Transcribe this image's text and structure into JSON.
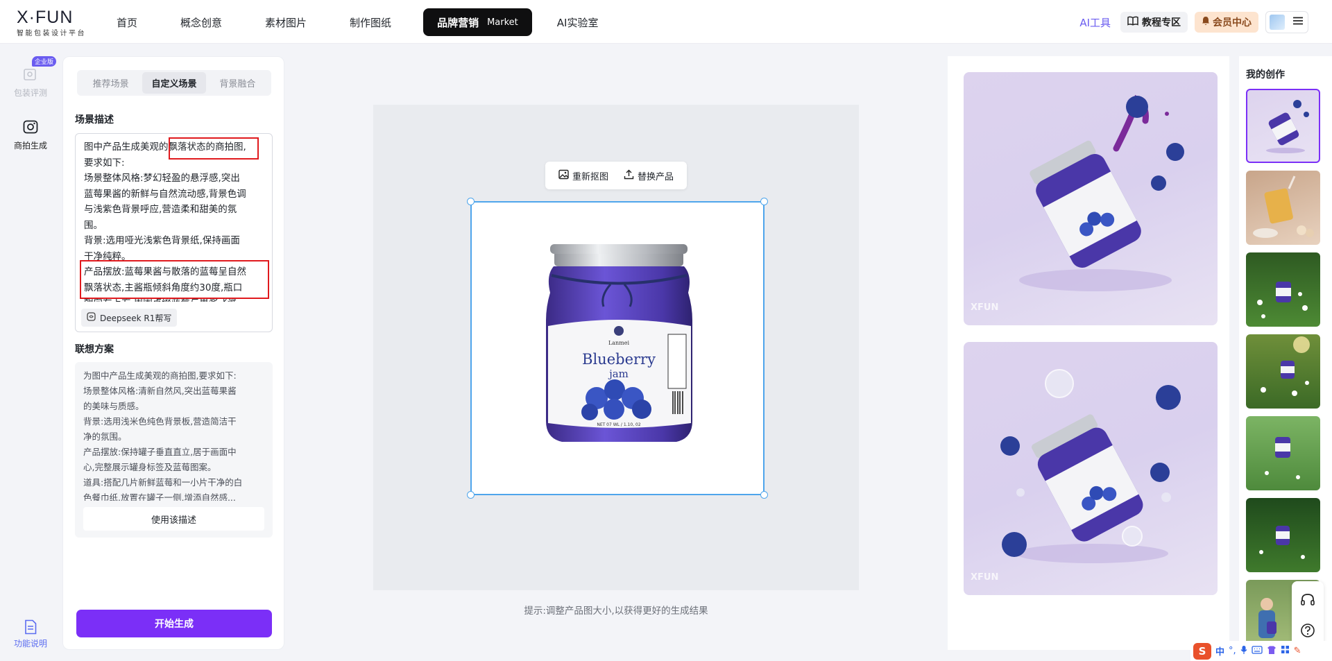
{
  "header": {
    "logo_main": "X·FUN",
    "logo_sub": "智能包装设计平台",
    "nav": [
      {
        "label": "首页"
      },
      {
        "label": "概念创意"
      },
      {
        "label": "素材图片"
      },
      {
        "label": "制作图纸"
      },
      {
        "label": "品牌营销",
        "sub": "Market",
        "active": true
      },
      {
        "label": "AI实验室"
      }
    ],
    "ai_tools": "AI工具",
    "tutorial": "教程专区",
    "member": "会员中心"
  },
  "rail": {
    "items": [
      {
        "label": "包装评测",
        "badge": "企业版",
        "icon": "package-review-icon"
      },
      {
        "label": "商拍生成",
        "icon": "camera-icon"
      }
    ],
    "bottom": {
      "label": "功能说明",
      "icon": "document-icon"
    }
  },
  "panel": {
    "tabs": [
      "推荐场景",
      "自定义场景",
      "背景融合"
    ],
    "active_tab": 1,
    "scene_title": "场景描述",
    "scene_lines": [
      "图中产品生成美观的飘落状态的商拍图,",
      "要求如下:",
      "场景整体风格:梦幻轻盈的悬浮感,突出",
      "蓝莓果酱的新鲜与自然流动感,背景色调",
      "与浅紫色背景呼应,营造柔和甜美的氛",
      "围。",
      "背景:选用哑光浅紫色背景纸,保持画面",
      "干净纯粹。",
      "产品摆放:蓝莓果酱与散落的蓝莓呈自然",
      "飘落状态,主酱瓶倾斜角度约30度,瓶口",
      "朝向右上方,周围点缀蓝莓与果酱飞溅。"
    ],
    "deepseek_btn": "Deepseek R1帮写",
    "plan_title": "联想方案",
    "plan_lines": [
      "为图中产品生成美观的商拍图,要求如下:",
      "场景整体风格:清新自然风,突出蓝莓果酱",
      "的美味与质感。",
      "背景:选用浅米色纯色背景板,营造简洁干",
      "净的氛围。",
      "产品摆放:保持罐子垂直直立,居于画面中",
      "心,完整展示罐身标签及蓝莓图案。",
      "道具:搭配几片新鲜蓝莓和一小片干净的白",
      "色餐巾纸,放置在罐子一侧,增添自然感..."
    ],
    "use_btn": "使用该描述",
    "generate_btn": "开始生成"
  },
  "canvas": {
    "rematting": "重新抠图",
    "replace": "替换产品",
    "hint": "提示:调整产品图大小,以获得更好的生成结果",
    "jar": {
      "brand": "Lanmei",
      "title": "Blueberry",
      "subtitle": "jam",
      "net": "NET 07 WL / 1.10, 02"
    }
  },
  "results": {
    "watermark": "XFUN"
  },
  "history": {
    "title": "我的创作"
  },
  "ime": {
    "lang": "中"
  },
  "colors": {
    "accent": "#7b2ff7",
    "brand": "#6a5cf0",
    "select": "#4ea5ec",
    "highlight": "#e0191d"
  }
}
